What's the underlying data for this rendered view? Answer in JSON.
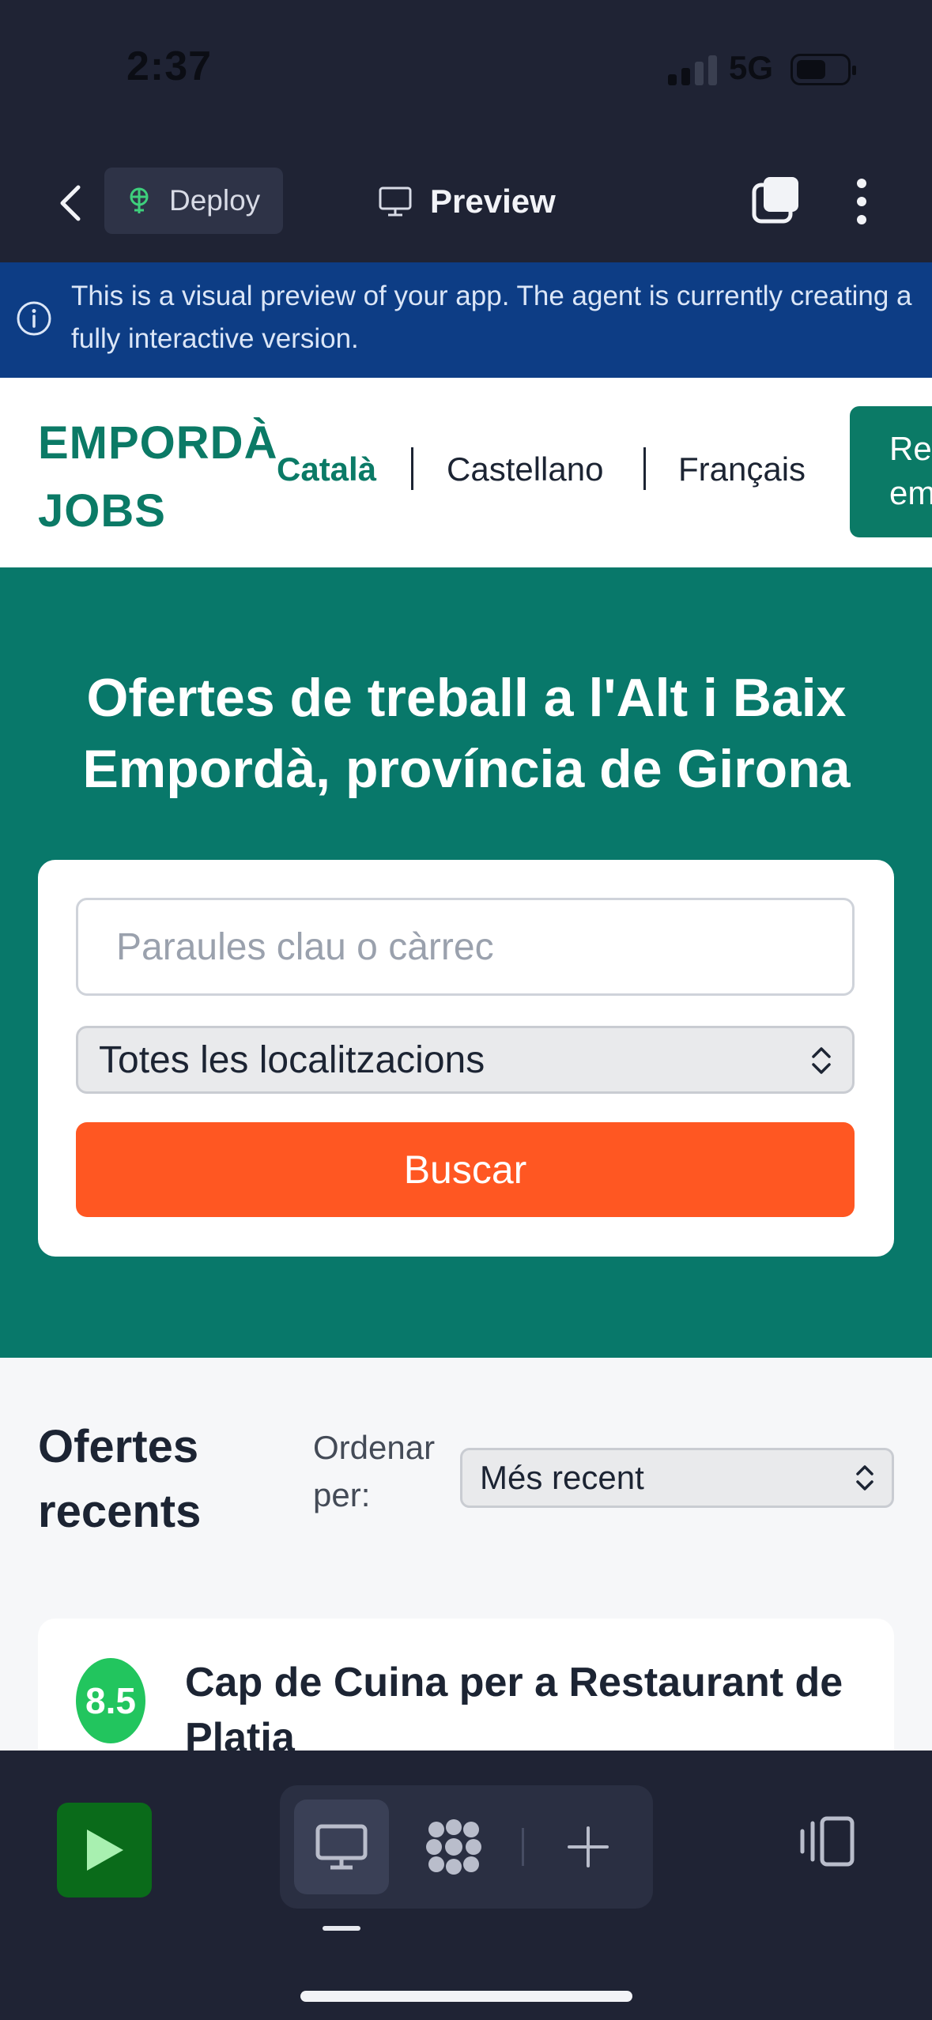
{
  "status_bar": {
    "time": "2:37",
    "network": "5G"
  },
  "toolbar": {
    "deploy_label": "Deploy",
    "preview_label": "Preview"
  },
  "notice": {
    "text": "This is a visual preview of your app. The agent is currently creating a fully interactive version."
  },
  "site": {
    "logo_line1": "EMPORDÀ",
    "logo_line2": "JOBS",
    "languages": [
      "Català",
      "Castellano",
      "Français"
    ],
    "active_language": "Català",
    "cta_line1": "Rec",
    "cta_line2": "em"
  },
  "hero": {
    "title": "Ofertes de treball a l'Alt i Baix Empordà, província de Girona",
    "search": {
      "keyword_placeholder": "Paraules clau o càrrec",
      "location_value": "Totes les localitzacions",
      "button_label": "Buscar"
    }
  },
  "recent": {
    "title": "Ofertes recents",
    "sort_label": "Ordenar per:",
    "sort_value": "Més recent",
    "jobs": [
      {
        "score": "8.5",
        "title": "Cap de Cuina per a Restaurant de Platja"
      }
    ]
  },
  "colors": {
    "brand_green": "#08786a",
    "accent_orange": "#ff5722",
    "score_green": "#22c55e",
    "notice_blue": "#0d3d85"
  }
}
